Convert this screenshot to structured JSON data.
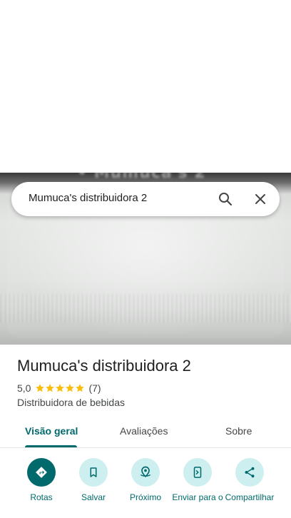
{
  "search": {
    "query": "Mumuca's distribuidora 2"
  },
  "place": {
    "title": "Mumuca's distribuidora 2",
    "rating": "5,0",
    "stars": 5,
    "review_count": "(7)",
    "category": "Distribuidora de bebidas"
  },
  "tabs": [
    {
      "label": "Visão geral",
      "active": true
    },
    {
      "label": "Avaliações",
      "active": false
    },
    {
      "label": "Sobre",
      "active": false
    }
  ],
  "actions": [
    {
      "label": "Rotas",
      "icon": "directions-icon"
    },
    {
      "label": "Salvar",
      "icon": "bookmark-icon"
    },
    {
      "label": "Próximo",
      "icon": "nearby-icon"
    },
    {
      "label": "Enviar para o",
      "icon": "send-to-phone-icon"
    },
    {
      "label": "Compartilhar",
      "icon": "share-icon"
    }
  ],
  "colors": {
    "accent": "#00696b",
    "accent_light": "#cdeff0",
    "star": "#fbbc04"
  }
}
